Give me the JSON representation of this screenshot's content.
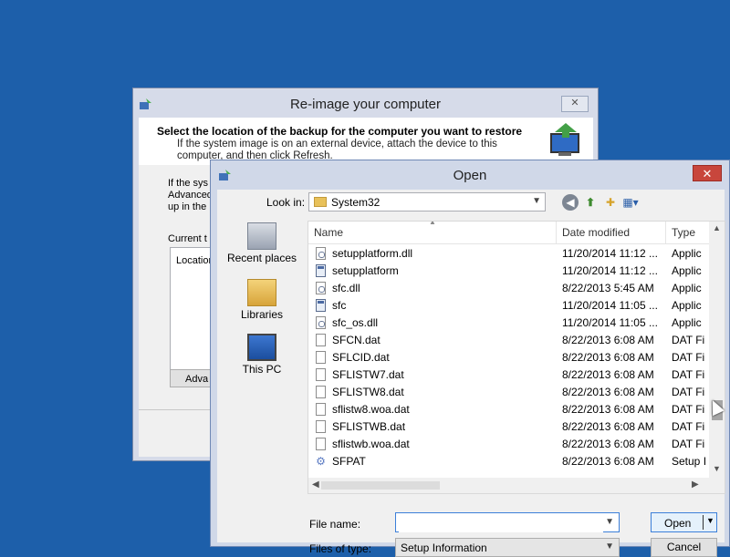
{
  "reimage": {
    "title": "Re-image your computer",
    "heading": "Select the location of the backup for the computer you want to restore",
    "subtext": "If the system image is on an external device, attach the device to this computer, and then click Refresh.",
    "body_text": "If the sys Advanced up in the",
    "current_label": "Current t",
    "list_col": "Location",
    "advanced_btn": "Adva",
    "close": "✕"
  },
  "open": {
    "title": "Open",
    "close": "✕",
    "lookin_label": "Look in:",
    "lookin_value": "System32",
    "places": [
      {
        "label": "Recent places",
        "icon": "recent-places-icon"
      },
      {
        "label": "Libraries",
        "icon": "libraries-icon"
      },
      {
        "label": "This PC",
        "icon": "this-pc-icon"
      }
    ],
    "columns": {
      "name": "Name",
      "date": "Date modified",
      "type": "Type"
    },
    "files": [
      {
        "name": "setupplatform.dll",
        "date": "11/20/2014 11:12 ...",
        "type": "Applic",
        "kind": "dll"
      },
      {
        "name": "setupplatform",
        "date": "11/20/2014 11:12 ...",
        "type": "Applic",
        "kind": "exe"
      },
      {
        "name": "sfc.dll",
        "date": "8/22/2013 5:45 AM",
        "type": "Applic",
        "kind": "dll"
      },
      {
        "name": "sfc",
        "date": "11/20/2014 11:05 ...",
        "type": "Applic",
        "kind": "exe"
      },
      {
        "name": "sfc_os.dll",
        "date": "11/20/2014 11:05 ...",
        "type": "Applic",
        "kind": "dll"
      },
      {
        "name": "SFCN.dat",
        "date": "8/22/2013 6:08 AM",
        "type": "DAT Fi",
        "kind": "dat"
      },
      {
        "name": "SFLCID.dat",
        "date": "8/22/2013 6:08 AM",
        "type": "DAT Fi",
        "kind": "dat"
      },
      {
        "name": "SFLISTW7.dat",
        "date": "8/22/2013 6:08 AM",
        "type": "DAT Fi",
        "kind": "dat"
      },
      {
        "name": "SFLISTW8.dat",
        "date": "8/22/2013 6:08 AM",
        "type": "DAT Fi",
        "kind": "dat"
      },
      {
        "name": "sflistw8.woa.dat",
        "date": "8/22/2013 6:08 AM",
        "type": "DAT Fi",
        "kind": "dat"
      },
      {
        "name": "SFLISTWB.dat",
        "date": "8/22/2013 6:08 AM",
        "type": "DAT Fi",
        "kind": "dat"
      },
      {
        "name": "sflistwb.woa.dat",
        "date": "8/22/2013 6:08 AM",
        "type": "DAT Fi",
        "kind": "dat"
      },
      {
        "name": "SFPAT",
        "date": "8/22/2013 6:08 AM",
        "type": "Setup I",
        "kind": "set"
      }
    ],
    "filename_label": "File name:",
    "filename_value": "",
    "filetype_label": "Files of type:",
    "filetype_value": "Setup Information",
    "open_btn": "Open",
    "cancel_btn": "Cancel"
  }
}
